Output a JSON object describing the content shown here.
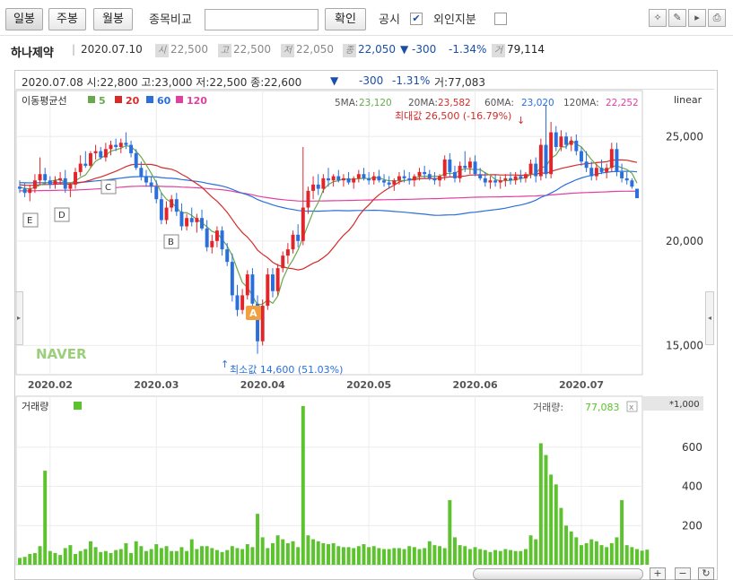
{
  "toolbar": {
    "daily": "일봉",
    "weekly": "주봉",
    "monthly": "월봉",
    "compare_label": "종목비교",
    "confirm": "확인",
    "disclosure": "공시",
    "foreign": "외인지분",
    "disclosure_checked": "✔"
  },
  "info": {
    "name": "하나제약",
    "date": "2020.07.10",
    "open_tag": "시",
    "open": "22,500",
    "high_tag": "고",
    "high": "22,500",
    "low_tag": "저",
    "low": "22,050",
    "close_tag": "종",
    "close": "22,050",
    "change": "▼ -300",
    "pct": "-1.34%",
    "vol_tag": "거",
    "volume": "79,114"
  },
  "header": {
    "text": "2020.07.08 시:22,800 고:23,000 저:22,500 종:22,600",
    "arrow": "▼",
    "change": "-300",
    "pct": "-1.31%",
    "volume": "거:77,083"
  },
  "legend": {
    "ma_label": "이동평균선",
    "ma5": "5",
    "ma20": "20",
    "ma60": "60",
    "ma120": "120",
    "v5_label": "5MA:",
    "v5": "23,120",
    "v20_label": "20MA:",
    "v20": "23,582",
    "v60_label": "60MA:",
    "v60": "23,020",
    "v120_label": "120MA:",
    "v120": "22,252",
    "scale": "linear"
  },
  "vol_panel": {
    "label": "거래량",
    "value_label": "거래량:",
    "value": "77,083",
    "unit": "*1,000",
    "close_x": "x"
  },
  "annotations": {
    "max": "최대값 26,500 (-16.79%)",
    "min": "최소값 14,600 (51.03%)",
    "A": "A",
    "B": "B",
    "C": "C",
    "D": "D",
    "E": "E"
  },
  "watermark": "NAVER",
  "colors": {
    "up": "#e1262b",
    "down": "#2a6fdb",
    "ma5": "#6aa84f",
    "ma20": "#d52b2b",
    "ma60": "#2a6fdb",
    "ma120": "#e040a0",
    "volume": "#5cc22e"
  },
  "chart_data": {
    "type": "candlestick",
    "x_ticks": [
      "2020.02",
      "2020.03",
      "2020.04",
      "2020.05",
      "2020.06",
      "2020.07"
    ],
    "y_ticks": [
      "15,000",
      "20,000",
      "25,000"
    ],
    "ylim": [
      13600,
      27200
    ],
    "vol_ticks": [
      "200",
      "400",
      "600"
    ],
    "vol_ylim": [
      0,
      860
    ],
    "candles": [
      [
        22600,
        22900,
        22300,
        22500
      ],
      [
        22500,
        22800,
        22100,
        22300
      ],
      [
        22300,
        22700,
        21900,
        22500
      ],
      [
        22500,
        23200,
        22300,
        22900
      ],
      [
        22900,
        24000,
        22700,
        23200
      ],
      [
        23200,
        23500,
        22700,
        22900
      ],
      [
        22900,
        23100,
        22500,
        22700
      ],
      [
        22700,
        23100,
        22500,
        22900
      ],
      [
        22900,
        23300,
        22700,
        23000
      ],
      [
        23000,
        23400,
        22300,
        22500
      ],
      [
        22500,
        22800,
        22100,
        22700
      ],
      [
        22700,
        23500,
        22500,
        23300
      ],
      [
        23300,
        24100,
        23100,
        23700
      ],
      [
        23700,
        24300,
        23500,
        23600
      ],
      [
        23600,
        24300,
        23500,
        24200
      ],
      [
        24200,
        24600,
        23900,
        24300
      ],
      [
        24300,
        24500,
        23900,
        24000
      ],
      [
        24000,
        24700,
        23800,
        24400
      ],
      [
        24400,
        24800,
        24100,
        24600
      ],
      [
        24600,
        24900,
        24300,
        24500
      ],
      [
        24500,
        24900,
        24200,
        24700
      ],
      [
        24700,
        25200,
        24400,
        24600
      ],
      [
        24600,
        24800,
        24000,
        24200
      ],
      [
        24200,
        24400,
        23400,
        23500
      ],
      [
        23500,
        23800,
        22900,
        23100
      ],
      [
        23100,
        23400,
        22600,
        22800
      ],
      [
        22800,
        23100,
        22300,
        22600
      ],
      [
        22600,
        22900,
        21800,
        22000
      ],
      [
        22000,
        22300,
        20800,
        21000
      ],
      [
        21000,
        21900,
        20800,
        21600
      ],
      [
        21600,
        22200,
        21400,
        22000
      ],
      [
        22000,
        22300,
        21200,
        21400
      ],
      [
        21400,
        21800,
        20500,
        20700
      ],
      [
        20700,
        21300,
        20500,
        21100
      ],
      [
        21100,
        21600,
        20700,
        20900
      ],
      [
        20900,
        21300,
        20400,
        21100
      ],
      [
        21100,
        21500,
        20500,
        20600
      ],
      [
        20600,
        21000,
        19500,
        19700
      ],
      [
        19700,
        20300,
        19400,
        20000
      ],
      [
        20000,
        20700,
        19700,
        20500
      ],
      [
        20500,
        20700,
        19300,
        19600
      ],
      [
        19600,
        19900,
        18800,
        19000
      ],
      [
        19000,
        19400,
        17100,
        17400
      ],
      [
        17400,
        17900,
        16400,
        16700
      ],
      [
        16700,
        17700,
        16500,
        17400
      ],
      [
        17400,
        18600,
        17200,
        18400
      ],
      [
        18400,
        18700,
        16800,
        17000
      ],
      [
        17000,
        17400,
        14600,
        15200
      ],
      [
        15200,
        17200,
        15000,
        16900
      ],
      [
        16900,
        18700,
        16700,
        18400
      ],
      [
        18400,
        18700,
        17300,
        17600
      ],
      [
        17600,
        18900,
        17400,
        18700
      ],
      [
        18700,
        19500,
        18500,
        19300
      ],
      [
        19300,
        19900,
        18900,
        19600
      ],
      [
        19600,
        20500,
        19400,
        20300
      ],
      [
        20300,
        20800,
        19700,
        20000
      ],
      [
        20000,
        24500,
        19800,
        21600
      ],
      [
        21600,
        22600,
        21300,
        22400
      ],
      [
        22400,
        23100,
        22000,
        22700
      ],
      [
        22700,
        23200,
        22200,
        22500
      ],
      [
        22500,
        23200,
        22300,
        23000
      ],
      [
        23000,
        23500,
        22600,
        22900
      ],
      [
        22900,
        23200,
        22600,
        23100
      ],
      [
        23100,
        23400,
        22800,
        22900
      ],
      [
        22900,
        23200,
        22600,
        23000
      ],
      [
        23000,
        23300,
        22700,
        22800
      ],
      [
        22800,
        23100,
        22500,
        23000
      ],
      [
        23000,
        23400,
        22800,
        23200
      ],
      [
        23200,
        23500,
        22900,
        23000
      ],
      [
        23000,
        23300,
        22700,
        22900
      ],
      [
        22900,
        23300,
        22700,
        23100
      ],
      [
        23100,
        23400,
        22800,
        22900
      ],
      [
        22900,
        23200,
        22600,
        22800
      ],
      [
        22800,
        23100,
        22500,
        22700
      ],
      [
        22700,
        23000,
        22400,
        22900
      ],
      [
        22900,
        23300,
        22700,
        23100
      ],
      [
        23100,
        23400,
        22800,
        23000
      ],
      [
        23000,
        23300,
        22700,
        22900
      ],
      [
        22900,
        23200,
        22600,
        23100
      ],
      [
        23100,
        23500,
        22900,
        23300
      ],
      [
        23300,
        23600,
        23000,
        23200
      ],
      [
        23200,
        23400,
        22900,
        23000
      ],
      [
        23000,
        23300,
        22700,
        22900
      ],
      [
        22900,
        23200,
        22600,
        23100
      ],
      [
        23100,
        24100,
        22900,
        23900
      ],
      [
        23900,
        24200,
        23100,
        23300
      ],
      [
        23300,
        23600,
        22800,
        23000
      ],
      [
        23000,
        23800,
        22800,
        23600
      ],
      [
        23600,
        24300,
        23300,
        23500
      ],
      [
        23500,
        24000,
        23200,
        23800
      ],
      [
        23800,
        24100,
        23100,
        23200
      ],
      [
        23200,
        23500,
        22900,
        23000
      ],
      [
        23000,
        23300,
        22600,
        22800
      ],
      [
        22800,
        23100,
        22500,
        22900
      ],
      [
        22900,
        23200,
        22600,
        22800
      ],
      [
        22800,
        23100,
        22500,
        22900
      ],
      [
        22900,
        23200,
        22600,
        23000
      ],
      [
        23000,
        23300,
        22700,
        22900
      ],
      [
        22900,
        23300,
        22700,
        23100
      ],
      [
        23100,
        23400,
        22800,
        23000
      ],
      [
        23000,
        23300,
        22800,
        23200
      ],
      [
        23200,
        23900,
        23000,
        23700
      ],
      [
        23700,
        24000,
        22800,
        23100
      ],
      [
        23100,
        24900,
        22900,
        24600
      ],
      [
        24600,
        26500,
        23000,
        23200
      ],
      [
        23200,
        25700,
        23000,
        25200
      ],
      [
        25200,
        25500,
        24300,
        24500
      ],
      [
        24500,
        25300,
        24300,
        25000
      ],
      [
        25000,
        25200,
        24400,
        24600
      ],
      [
        24600,
        25000,
        24300,
        24800
      ],
      [
        24800,
        25100,
        24100,
        24300
      ],
      [
        24300,
        24500,
        23600,
        23800
      ],
      [
        23800,
        24300,
        23300,
        23500
      ],
      [
        23500,
        23800,
        22900,
        23100
      ],
      [
        23100,
        23700,
        22900,
        23500
      ],
      [
        23500,
        23900,
        23200,
        23300
      ],
      [
        23300,
        23700,
        23000,
        23500
      ],
      [
        23500,
        24700,
        23300,
        24400
      ],
      [
        24400,
        24700,
        23100,
        23300
      ],
      [
        23300,
        23700,
        22800,
        23000
      ],
      [
        23000,
        23300,
        22700,
        22900
      ],
      [
        22900,
        23000,
        22500,
        22600
      ],
      [
        22500,
        22500,
        22050,
        22050
      ]
    ],
    "volume": [
      35,
      40,
      55,
      60,
      95,
      480,
      70,
      60,
      50,
      85,
      100,
      55,
      70,
      80,
      120,
      90,
      65,
      70,
      60,
      75,
      80,
      110,
      60,
      120,
      95,
      70,
      80,
      105,
      85,
      95,
      70,
      70,
      90,
      70,
      130,
      80,
      95,
      95,
      85,
      75,
      65,
      75,
      95,
      85,
      80,
      105,
      90,
      260,
      140,
      85,
      110,
      150,
      130,
      110,
      120,
      90,
      810,
      150,
      130,
      120,
      110,
      105,
      110,
      95,
      90,
      90,
      85,
      95,
      105,
      90,
      95,
      85,
      80,
      80,
      85,
      85,
      80,
      95,
      90,
      80,
      85,
      120,
      100,
      95,
      85,
      330,
      140,
      100,
      95,
      80,
      90,
      80,
      75,
      65,
      75,
      70,
      80,
      75,
      70,
      70,
      80,
      150,
      130,
      620,
      560,
      460,
      410,
      290,
      200,
      170,
      140,
      100,
      110,
      130,
      120,
      100,
      90,
      110,
      140,
      330,
      100,
      90,
      80,
      72,
      77
    ]
  }
}
